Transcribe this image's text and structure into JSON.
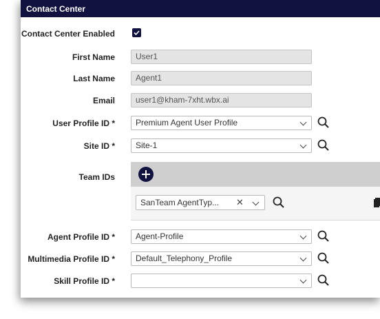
{
  "window": {
    "title": "Contact Center"
  },
  "fields": {
    "contact_center_enabled": {
      "label": "Contact Center Enabled",
      "checked": true
    },
    "first_name": {
      "label": "First Name",
      "value": "User1"
    },
    "last_name": {
      "label": "Last Name",
      "value": "Agent1"
    },
    "email": {
      "label": "Email",
      "value": "user1@kham-7xht.wbx.ai"
    },
    "user_profile_id": {
      "label": "User Profile ID *",
      "value": "Premium Agent User Profile"
    },
    "site_id": {
      "label": "Site ID *",
      "value": "Site-1"
    },
    "team_ids": {
      "label": "Team IDs",
      "selected": "SanTeam AgentTyp..."
    },
    "agent_profile_id": {
      "label": "Agent Profile ID *",
      "value": "Agent-Profile"
    },
    "multimedia_profile_id": {
      "label": "Multimedia Profile ID *",
      "value": "Default_Telephony_Profile"
    },
    "skill_profile_id": {
      "label": "Skill Profile ID *",
      "value": ""
    }
  },
  "colors": {
    "accent": "#11123f",
    "readonly_bg": "#e4e4e4",
    "team_header_bg": "#cfcfcf"
  },
  "icons": [
    "check-icon",
    "chevron-down-icon",
    "search-icon",
    "plus-icon",
    "clear-icon",
    "copy-icon",
    "trash-icon"
  ]
}
